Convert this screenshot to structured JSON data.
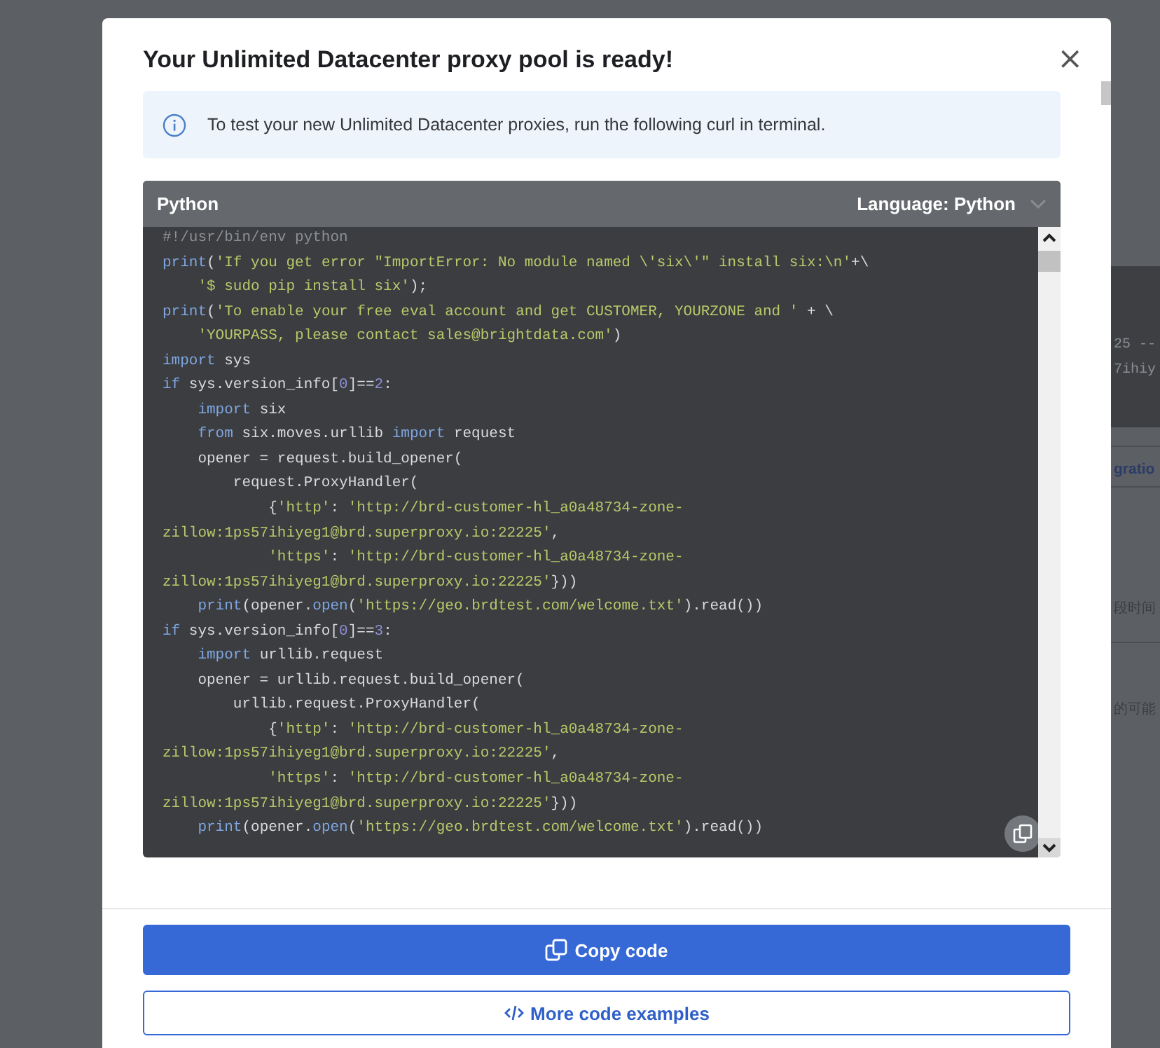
{
  "backdrop": {
    "fragments": [
      {
        "kind": "code",
        "text": "25 --"
      },
      {
        "kind": "code",
        "text": "7ihiy"
      },
      {
        "kind": "link",
        "text": "gratio"
      },
      {
        "kind": "plain",
        "text": "段时间"
      },
      {
        "kind": "plain",
        "text": "的可能"
      }
    ]
  },
  "dialog": {
    "title": "Your Unlimited Datacenter proxy pool is ready!",
    "close": "×",
    "info": "To test your new Unlimited Datacenter proxies, run the following curl in terminal.",
    "code": {
      "label": "Python",
      "language": "Language: Python",
      "lines": [
        [
          {
            "kind": "comment",
            "text": "#!/usr/bin/env python"
          }
        ],
        [
          {
            "kind": "keyword",
            "text": "print"
          },
          {
            "kind": "plain",
            "text": "("
          },
          {
            "kind": "string",
            "text": "'If you get error \"ImportError: No module named \\'six\\'\" install six:\\n'"
          },
          {
            "kind": "plain",
            "text": "+\\"
          }
        ],
        [
          {
            "kind": "string",
            "text": "    '$ sudo pip install six'"
          },
          {
            "kind": "plain",
            "text": ");"
          }
        ],
        [
          {
            "kind": "keyword",
            "text": "print"
          },
          {
            "kind": "plain",
            "text": "("
          },
          {
            "kind": "string",
            "text": "'To enable your free eval account and get CUSTOMER, YOURZONE and '"
          },
          {
            "kind": "plain",
            "text": " + \\"
          }
        ],
        [
          {
            "kind": "string",
            "text": "    'YOURPASS, please contact sales@brightdata.com'"
          },
          {
            "kind": "plain",
            "text": ")"
          }
        ],
        [
          {
            "kind": "keyword",
            "text": "import"
          },
          {
            "kind": "plain",
            "text": " sys"
          }
        ],
        [
          {
            "kind": "keyword",
            "text": "if"
          },
          {
            "kind": "plain",
            "text": " sys.version_info["
          },
          {
            "kind": "number",
            "text": "0"
          },
          {
            "kind": "plain",
            "text": "]=="
          },
          {
            "kind": "number",
            "text": "2"
          },
          {
            "kind": "plain",
            "text": ":"
          }
        ],
        [
          {
            "kind": "keyword",
            "text": "    import"
          },
          {
            "kind": "plain",
            "text": " six"
          }
        ],
        [
          {
            "kind": "keyword",
            "text": "    from"
          },
          {
            "kind": "plain",
            "text": " six.moves.urllib "
          },
          {
            "kind": "keyword",
            "text": "import"
          },
          {
            "kind": "plain",
            "text": " request"
          }
        ],
        [
          {
            "kind": "plain",
            "text": "    opener = request.build_opener("
          }
        ],
        [
          {
            "kind": "plain",
            "text": "        request.ProxyHandler("
          }
        ],
        [
          {
            "kind": "plain",
            "text": "            {"
          },
          {
            "kind": "string",
            "text": "'http'"
          },
          {
            "kind": "plain",
            "text": ": "
          },
          {
            "kind": "string",
            "text": "'http://brd-customer-hl_a0a48734-zone-"
          }
        ],
        [
          {
            "kind": "string",
            "text": "zillow:1ps57ihiyeg1@brd.superproxy.io:22225'"
          },
          {
            "kind": "plain",
            "text": ","
          }
        ],
        [
          {
            "kind": "string",
            "text": "            'https'"
          },
          {
            "kind": "plain",
            "text": ": "
          },
          {
            "kind": "string",
            "text": "'http://brd-customer-hl_a0a48734-zone-"
          }
        ],
        [
          {
            "kind": "string",
            "text": "zillow:1ps57ihiyeg1@brd.superproxy.io:22225'"
          },
          {
            "kind": "plain",
            "text": "}))"
          }
        ],
        [
          {
            "kind": "keyword",
            "text": "    print"
          },
          {
            "kind": "plain",
            "text": "(opener."
          },
          {
            "kind": "keyword",
            "text": "open"
          },
          {
            "kind": "plain",
            "text": "("
          },
          {
            "kind": "string",
            "text": "'https://geo.brdtest.com/welcome.txt'"
          },
          {
            "kind": "plain",
            "text": ").read())"
          }
        ],
        [
          {
            "kind": "keyword",
            "text": "if"
          },
          {
            "kind": "plain",
            "text": " sys.version_info["
          },
          {
            "kind": "number",
            "text": "0"
          },
          {
            "kind": "plain",
            "text": "]=="
          },
          {
            "kind": "number",
            "text": "3"
          },
          {
            "kind": "plain",
            "text": ":"
          }
        ],
        [
          {
            "kind": "keyword",
            "text": "    import"
          },
          {
            "kind": "plain",
            "text": " urllib.request"
          }
        ],
        [
          {
            "kind": "plain",
            "text": "    opener = urllib.request.build_opener("
          }
        ],
        [
          {
            "kind": "plain",
            "text": "        urllib.request.ProxyHandler("
          }
        ],
        [
          {
            "kind": "plain",
            "text": "            {"
          },
          {
            "kind": "string",
            "text": "'http'"
          },
          {
            "kind": "plain",
            "text": ": "
          },
          {
            "kind": "string",
            "text": "'http://brd-customer-hl_a0a48734-zone-"
          }
        ],
        [
          {
            "kind": "string",
            "text": "zillow:1ps57ihiyeg1@brd.superproxy.io:22225'"
          },
          {
            "kind": "plain",
            "text": ","
          }
        ],
        [
          {
            "kind": "string",
            "text": "            'https'"
          },
          {
            "kind": "plain",
            "text": ": "
          },
          {
            "kind": "string",
            "text": "'http://brd-customer-hl_a0a48734-zone-"
          }
        ],
        [
          {
            "kind": "string",
            "text": "zillow:1ps57ihiyeg1@brd.superproxy.io:22225'"
          },
          {
            "kind": "plain",
            "text": "}))"
          }
        ],
        [
          {
            "kind": "keyword",
            "text": "    print"
          },
          {
            "kind": "plain",
            "text": "(opener."
          },
          {
            "kind": "keyword",
            "text": "open"
          },
          {
            "kind": "plain",
            "text": "("
          },
          {
            "kind": "string",
            "text": "'https://geo.brdtest.com/welcome.txt'"
          },
          {
            "kind": "plain",
            "text": ").read())"
          }
        ]
      ]
    },
    "buttons": [
      {
        "kind": "primary",
        "label": "Copy code"
      },
      {
        "kind": "secondary",
        "label": "More code examples"
      }
    ]
  }
}
